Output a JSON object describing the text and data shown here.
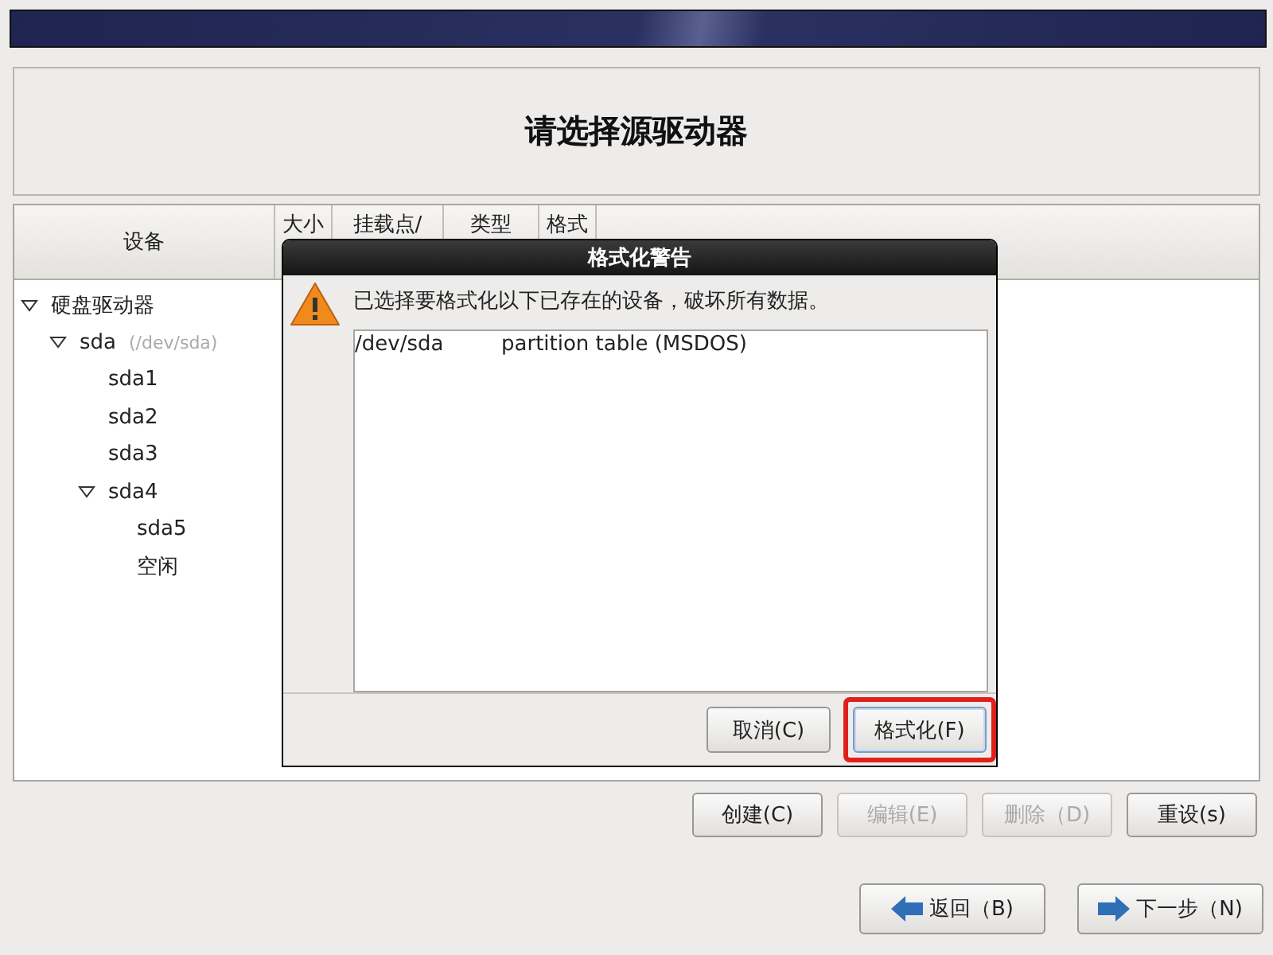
{
  "header": {
    "title": "请选择源驱动器"
  },
  "table": {
    "columns": [
      {
        "label": "设备"
      },
      {
        "label": "大小"
      },
      {
        "label": "挂载点/"
      },
      {
        "label": "类型"
      },
      {
        "label": "格式"
      }
    ],
    "tree": [
      {
        "label": "硬盘驱动器",
        "expanded": true,
        "children": [
          {
            "label": "sda",
            "detail": "(/dev/sda)",
            "expanded": true,
            "children": [
              {
                "label": "sda1"
              },
              {
                "label": "sda2"
              },
              {
                "label": "sda3"
              },
              {
                "label": "sda4",
                "expanded": true,
                "children": [
                  {
                    "label": "sda5"
                  },
                  {
                    "label": "空闲"
                  }
                ]
              }
            ]
          }
        ]
      }
    ]
  },
  "actions": [
    {
      "label": "创建(C)",
      "disabled": false
    },
    {
      "label": "编辑(E)",
      "disabled": true
    },
    {
      "label": "删除（D)",
      "disabled": true
    },
    {
      "label": "重设(s)",
      "disabled": false
    }
  ],
  "nav": [
    {
      "label": "返回（B)",
      "kind": "back"
    },
    {
      "label": "下一步（N)",
      "kind": "next"
    }
  ],
  "dialog": {
    "title": "格式化警告",
    "message": "已选择要格式化以下已存在的设备，破坏所有数据。",
    "rows": [
      {
        "device": "/dev/sda",
        "description": "partition table (MSDOS)"
      }
    ],
    "buttons": [
      {
        "label": "取消(C)",
        "highlighted": false
      },
      {
        "label": "格式化(F)",
        "highlighted": true
      }
    ]
  }
}
